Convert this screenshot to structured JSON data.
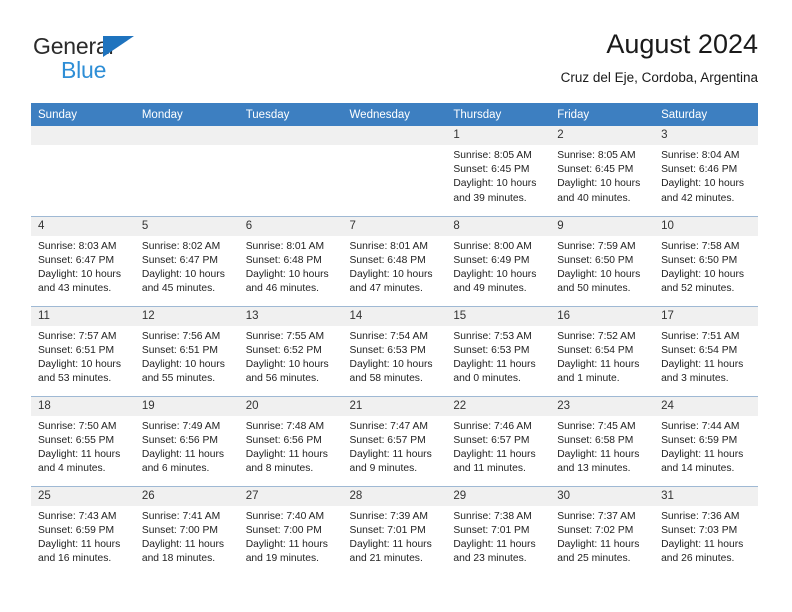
{
  "logo": {
    "word1": "General",
    "word2": "Blue",
    "triangle_color": "#1e73be",
    "word2_color": "#2e8ed6",
    "icon": "general-blue-logo"
  },
  "header": {
    "title": "August 2024",
    "subtitle": "Cruz del Eje, Cordoba, Argentina"
  },
  "theme": {
    "header_blue": "#3d7fc1",
    "daynum_band": "#f0f0f0",
    "grid_line": "#9fb9d4"
  },
  "weekday_headers": [
    "Sunday",
    "Monday",
    "Tuesday",
    "Wednesday",
    "Thursday",
    "Friday",
    "Saturday"
  ],
  "weeks": [
    [
      {
        "day": "",
        "empty": true
      },
      {
        "day": "",
        "empty": true
      },
      {
        "day": "",
        "empty": true
      },
      {
        "day": "",
        "empty": true
      },
      {
        "day": "1",
        "sunrise": "Sunrise: 8:05 AM",
        "sunset": "Sunset: 6:45 PM",
        "daylight": "Daylight: 10 hours and 39 minutes."
      },
      {
        "day": "2",
        "sunrise": "Sunrise: 8:05 AM",
        "sunset": "Sunset: 6:45 PM",
        "daylight": "Daylight: 10 hours and 40 minutes."
      },
      {
        "day": "3",
        "sunrise": "Sunrise: 8:04 AM",
        "sunset": "Sunset: 6:46 PM",
        "daylight": "Daylight: 10 hours and 42 minutes."
      }
    ],
    [
      {
        "day": "4",
        "sunrise": "Sunrise: 8:03 AM",
        "sunset": "Sunset: 6:47 PM",
        "daylight": "Daylight: 10 hours and 43 minutes."
      },
      {
        "day": "5",
        "sunrise": "Sunrise: 8:02 AM",
        "sunset": "Sunset: 6:47 PM",
        "daylight": "Daylight: 10 hours and 45 minutes."
      },
      {
        "day": "6",
        "sunrise": "Sunrise: 8:01 AM",
        "sunset": "Sunset: 6:48 PM",
        "daylight": "Daylight: 10 hours and 46 minutes."
      },
      {
        "day": "7",
        "sunrise": "Sunrise: 8:01 AM",
        "sunset": "Sunset: 6:48 PM",
        "daylight": "Daylight: 10 hours and 47 minutes."
      },
      {
        "day": "8",
        "sunrise": "Sunrise: 8:00 AM",
        "sunset": "Sunset: 6:49 PM",
        "daylight": "Daylight: 10 hours and 49 minutes."
      },
      {
        "day": "9",
        "sunrise": "Sunrise: 7:59 AM",
        "sunset": "Sunset: 6:50 PM",
        "daylight": "Daylight: 10 hours and 50 minutes."
      },
      {
        "day": "10",
        "sunrise": "Sunrise: 7:58 AM",
        "sunset": "Sunset: 6:50 PM",
        "daylight": "Daylight: 10 hours and 52 minutes."
      }
    ],
    [
      {
        "day": "11",
        "sunrise": "Sunrise: 7:57 AM",
        "sunset": "Sunset: 6:51 PM",
        "daylight": "Daylight: 10 hours and 53 minutes."
      },
      {
        "day": "12",
        "sunrise": "Sunrise: 7:56 AM",
        "sunset": "Sunset: 6:51 PM",
        "daylight": "Daylight: 10 hours and 55 minutes."
      },
      {
        "day": "13",
        "sunrise": "Sunrise: 7:55 AM",
        "sunset": "Sunset: 6:52 PM",
        "daylight": "Daylight: 10 hours and 56 minutes."
      },
      {
        "day": "14",
        "sunrise": "Sunrise: 7:54 AM",
        "sunset": "Sunset: 6:53 PM",
        "daylight": "Daylight: 10 hours and 58 minutes."
      },
      {
        "day": "15",
        "sunrise": "Sunrise: 7:53 AM",
        "sunset": "Sunset: 6:53 PM",
        "daylight": "Daylight: 11 hours and 0 minutes."
      },
      {
        "day": "16",
        "sunrise": "Sunrise: 7:52 AM",
        "sunset": "Sunset: 6:54 PM",
        "daylight": "Daylight: 11 hours and 1 minute."
      },
      {
        "day": "17",
        "sunrise": "Sunrise: 7:51 AM",
        "sunset": "Sunset: 6:54 PM",
        "daylight": "Daylight: 11 hours and 3 minutes."
      }
    ],
    [
      {
        "day": "18",
        "sunrise": "Sunrise: 7:50 AM",
        "sunset": "Sunset: 6:55 PM",
        "daylight": "Daylight: 11 hours and 4 minutes."
      },
      {
        "day": "19",
        "sunrise": "Sunrise: 7:49 AM",
        "sunset": "Sunset: 6:56 PM",
        "daylight": "Daylight: 11 hours and 6 minutes."
      },
      {
        "day": "20",
        "sunrise": "Sunrise: 7:48 AM",
        "sunset": "Sunset: 6:56 PM",
        "daylight": "Daylight: 11 hours and 8 minutes."
      },
      {
        "day": "21",
        "sunrise": "Sunrise: 7:47 AM",
        "sunset": "Sunset: 6:57 PM",
        "daylight": "Daylight: 11 hours and 9 minutes."
      },
      {
        "day": "22",
        "sunrise": "Sunrise: 7:46 AM",
        "sunset": "Sunset: 6:57 PM",
        "daylight": "Daylight: 11 hours and 11 minutes."
      },
      {
        "day": "23",
        "sunrise": "Sunrise: 7:45 AM",
        "sunset": "Sunset: 6:58 PM",
        "daylight": "Daylight: 11 hours and 13 minutes."
      },
      {
        "day": "24",
        "sunrise": "Sunrise: 7:44 AM",
        "sunset": "Sunset: 6:59 PM",
        "daylight": "Daylight: 11 hours and 14 minutes."
      }
    ],
    [
      {
        "day": "25",
        "sunrise": "Sunrise: 7:43 AM",
        "sunset": "Sunset: 6:59 PM",
        "daylight": "Daylight: 11 hours and 16 minutes."
      },
      {
        "day": "26",
        "sunrise": "Sunrise: 7:41 AM",
        "sunset": "Sunset: 7:00 PM",
        "daylight": "Daylight: 11 hours and 18 minutes."
      },
      {
        "day": "27",
        "sunrise": "Sunrise: 7:40 AM",
        "sunset": "Sunset: 7:00 PM",
        "daylight": "Daylight: 11 hours and 19 minutes."
      },
      {
        "day": "28",
        "sunrise": "Sunrise: 7:39 AM",
        "sunset": "Sunset: 7:01 PM",
        "daylight": "Daylight: 11 hours and 21 minutes."
      },
      {
        "day": "29",
        "sunrise": "Sunrise: 7:38 AM",
        "sunset": "Sunset: 7:01 PM",
        "daylight": "Daylight: 11 hours and 23 minutes."
      },
      {
        "day": "30",
        "sunrise": "Sunrise: 7:37 AM",
        "sunset": "Sunset: 7:02 PM",
        "daylight": "Daylight: 11 hours and 25 minutes."
      },
      {
        "day": "31",
        "sunrise": "Sunrise: 7:36 AM",
        "sunset": "Sunset: 7:03 PM",
        "daylight": "Daylight: 11 hours and 26 minutes."
      }
    ]
  ]
}
